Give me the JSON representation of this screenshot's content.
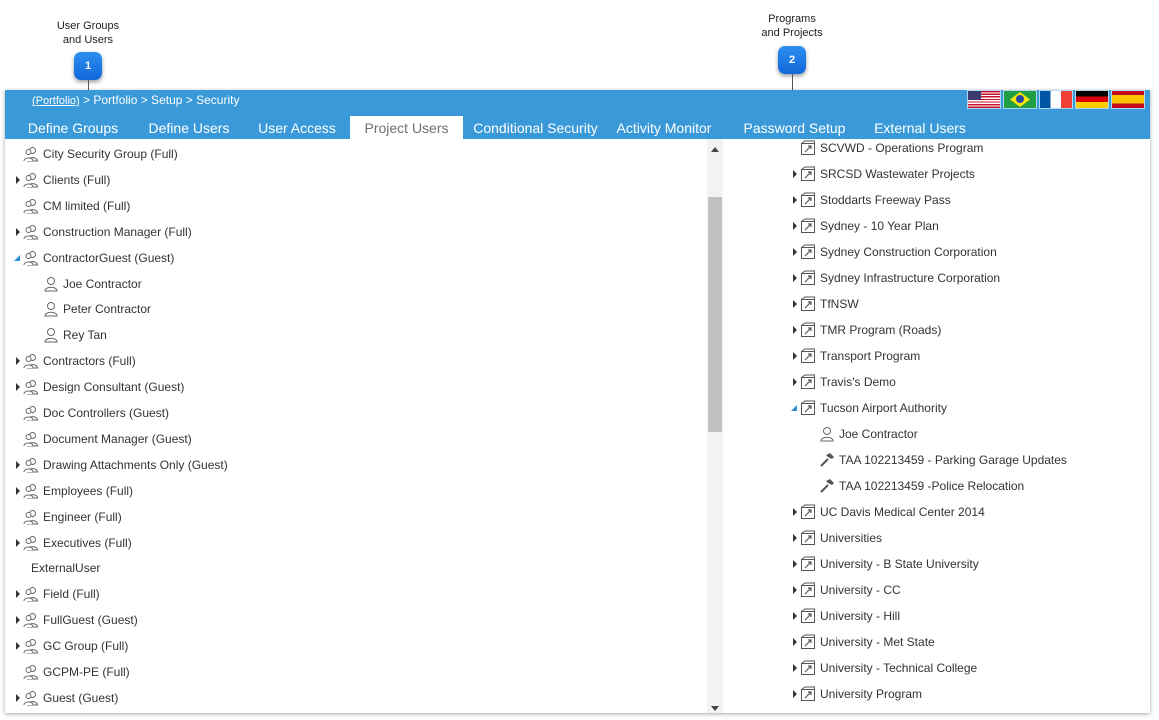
{
  "callouts": [
    {
      "number": "1",
      "label_line1": "User Groups",
      "label_line2": "and Users"
    },
    {
      "number": "2",
      "label_line1": "Programs",
      "label_line2": "and Projects"
    }
  ],
  "breadcrumb": {
    "link": "(Portfolio)",
    "path": " > Portfolio > Setup > Security"
  },
  "flags": [
    "flag-us-icon",
    "flag-brazil-icon",
    "flag-france-icon",
    "flag-germany-icon",
    "flag-spain-icon"
  ],
  "tabs": [
    {
      "label": "Define Groups",
      "active": false
    },
    {
      "label": "Define Users",
      "active": false
    },
    {
      "label": "User Access",
      "active": false
    },
    {
      "label": "Project Users",
      "active": true
    },
    {
      "label": "Conditional Security",
      "active": false
    },
    {
      "label": "Activity Monitor",
      "active": false
    },
    {
      "label": "Password Setup",
      "active": false
    },
    {
      "label": "External Users",
      "active": false
    }
  ],
  "left_tree": [
    {
      "label": "City Security Group (Full)",
      "type": "group",
      "expander": "none"
    },
    {
      "label": "Clients (Full)",
      "type": "group",
      "expander": "closed"
    },
    {
      "label": "CM limited (Full)",
      "type": "group",
      "expander": "none"
    },
    {
      "label": "Construction Manager (Full)",
      "type": "group",
      "expander": "closed"
    },
    {
      "label": "ContractorGuest (Guest)",
      "type": "group",
      "expander": "open"
    },
    {
      "label": "Joe Contractor",
      "type": "user",
      "expander": "none"
    },
    {
      "label": "Peter Contractor",
      "type": "user",
      "expander": "none"
    },
    {
      "label": "Rey Tan",
      "type": "user",
      "expander": "none"
    },
    {
      "label": "Contractors (Full)",
      "type": "group",
      "expander": "closed"
    },
    {
      "label": "Design Consultant (Guest)",
      "type": "group",
      "expander": "closed"
    },
    {
      "label": "Doc Controllers (Guest)",
      "type": "group",
      "expander": "none"
    },
    {
      "label": "Document Manager (Guest)",
      "type": "group",
      "expander": "none"
    },
    {
      "label": "Drawing Attachments Only (Guest)",
      "type": "group",
      "expander": "closed"
    },
    {
      "label": "Employees (Full)",
      "type": "group",
      "expander": "closed"
    },
    {
      "label": "Engineer (Full)",
      "type": "group",
      "expander": "none"
    },
    {
      "label": "Executives (Full)",
      "type": "group",
      "expander": "closed"
    },
    {
      "label": "ExternalUser",
      "type": "text",
      "expander": "none"
    },
    {
      "label": "Field (Full)",
      "type": "group",
      "expander": "closed"
    },
    {
      "label": "FullGuest (Guest)",
      "type": "group",
      "expander": "closed"
    },
    {
      "label": "GC Group (Full)",
      "type": "group",
      "expander": "closed"
    },
    {
      "label": "GCPM-PE (Full)",
      "type": "group",
      "expander": "none"
    },
    {
      "label": "Guest (Guest)",
      "type": "group",
      "expander": "closed"
    }
  ],
  "right_tree": [
    {
      "label": "SCVWD - Operations Program",
      "type": "program",
      "expander": "none"
    },
    {
      "label": "SRCSD Wastewater Projects",
      "type": "program",
      "expander": "closed"
    },
    {
      "label": "Stoddarts Freeway Pass",
      "type": "program",
      "expander": "closed"
    },
    {
      "label": "Sydney - 10 Year Plan",
      "type": "program",
      "expander": "closed"
    },
    {
      "label": "Sydney Construction Corporation",
      "type": "program",
      "expander": "closed"
    },
    {
      "label": "Sydney Infrastructure Corporation",
      "type": "program",
      "expander": "closed"
    },
    {
      "label": "TfNSW",
      "type": "program",
      "expander": "closed"
    },
    {
      "label": "TMR Program (Roads)",
      "type": "program",
      "expander": "closed"
    },
    {
      "label": "Transport Program",
      "type": "program",
      "expander": "closed"
    },
    {
      "label": "Travis's Demo",
      "type": "program",
      "expander": "closed"
    },
    {
      "label": "Tucson Airport Authority",
      "type": "program",
      "expander": "open"
    },
    {
      "label": "Joe Contractor",
      "type": "user",
      "expander": "none"
    },
    {
      "label": "TAA 102213459 - Parking Garage Updates",
      "type": "project",
      "expander": "none"
    },
    {
      "label": "TAA 102213459 -Police Relocation",
      "type": "project",
      "expander": "none"
    },
    {
      "label": "UC Davis Medical Center 2014",
      "type": "program",
      "expander": "closed"
    },
    {
      "label": "Universities",
      "type": "program",
      "expander": "closed"
    },
    {
      "label": "University - B State University",
      "type": "program",
      "expander": "closed"
    },
    {
      "label": "University - CC",
      "type": "program",
      "expander": "closed"
    },
    {
      "label": "University - Hill",
      "type": "program",
      "expander": "closed"
    },
    {
      "label": "University - Met State",
      "type": "program",
      "expander": "closed"
    },
    {
      "label": "University - Technical College",
      "type": "program",
      "expander": "closed"
    },
    {
      "label": "University Program",
      "type": "program",
      "expander": "closed"
    }
  ],
  "scrollbar": {
    "position_fraction": 0.1
  }
}
